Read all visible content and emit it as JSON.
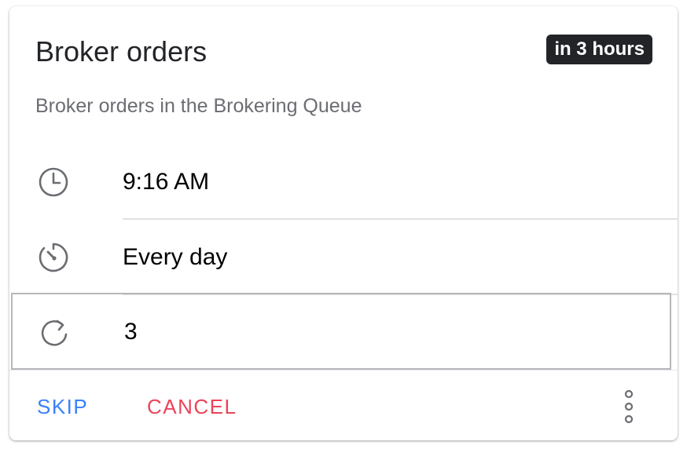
{
  "header": {
    "title": "Broker orders",
    "badge": "in 3 hours",
    "subtitle": "Broker orders in the Brokering Queue"
  },
  "rows": [
    {
      "icon": "clock-icon",
      "value": "9:16 AM"
    },
    {
      "icon": "timer-icon",
      "value": "Every day"
    },
    {
      "icon": "refresh-icon",
      "value": "3"
    }
  ],
  "actions": {
    "skip_label": "SKIP",
    "cancel_label": "CANCEL",
    "more_icon": "more-vertical-icon"
  },
  "colors": {
    "primary": "#3880ff",
    "danger": "#eb445a",
    "badge_bg": "#222428",
    "text": "#000000",
    "muted": "#6b6d72"
  }
}
